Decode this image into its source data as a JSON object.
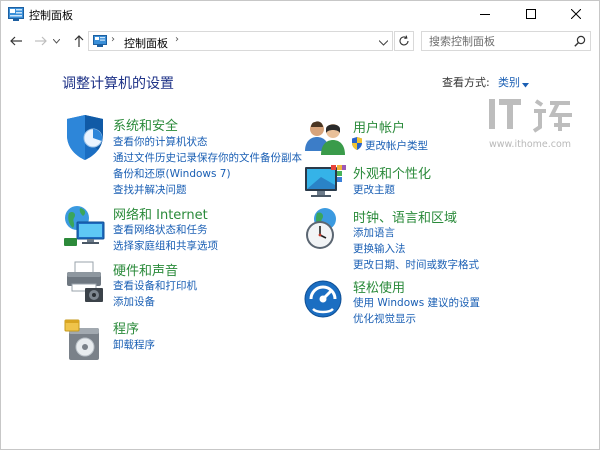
{
  "window": {
    "title": "控制面板"
  },
  "nav": {
    "address": "控制面板",
    "search_placeholder": "搜索控制面板"
  },
  "content": {
    "title": "调整计算机的设置",
    "view_by_label": "查看方式:",
    "view_by_value": "类别"
  },
  "categories": {
    "security": {
      "heading": "系统和安全",
      "links": [
        "查看你的计算机状态",
        "通过文件历史记录保存你的文件备份副本",
        "备份和还原(Windows 7)",
        "查找并解决问题"
      ]
    },
    "network": {
      "heading": "网络和 Internet",
      "links": [
        "查看网络状态和任务",
        "选择家庭组和共享选项"
      ]
    },
    "hardware": {
      "heading": "硬件和声音",
      "links": [
        "查看设备和打印机",
        "添加设备"
      ]
    },
    "programs": {
      "heading": "程序",
      "links": [
        "卸载程序"
      ]
    },
    "accounts": {
      "heading": "用户帐户",
      "links": [
        "更改帐户类型"
      ]
    },
    "appearance": {
      "heading": "外观和个性化",
      "links": [
        "更改主题"
      ]
    },
    "clock": {
      "heading": "时钟、语言和区域",
      "links": [
        "添加语言",
        "更换输入法",
        "更改日期、时间或数字格式"
      ]
    },
    "ease": {
      "heading": "轻松使用",
      "links": [
        "使用 Windows 建议的设置",
        "优化视觉显示"
      ]
    }
  },
  "watermark": {
    "logo": "IT之家",
    "url": "www.ithome.com"
  },
  "colors": {
    "heading_green": "#2a8a3a",
    "link_blue": "#1a5fb4",
    "title_blue": "#1e3287"
  }
}
